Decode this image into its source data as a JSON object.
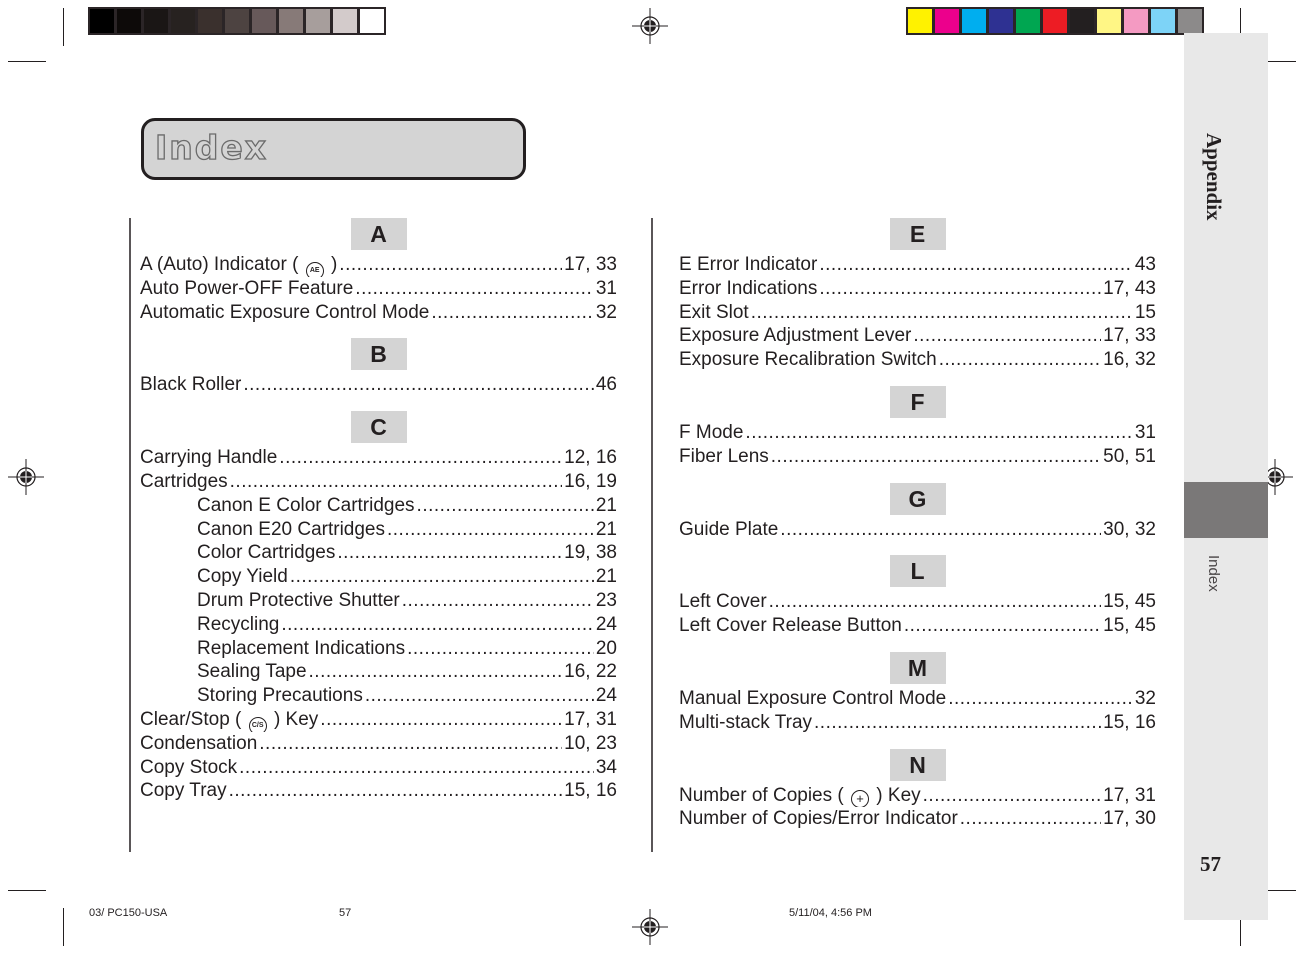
{
  "print_marks": {
    "gray_swatches": [
      "#000000",
      "#0d0a09",
      "#1a1615",
      "#272220",
      "#3a302d",
      "#4d4341",
      "#67595a",
      "#877a78",
      "#a79e9c",
      "#d3cbcb",
      "#ffffff"
    ],
    "color_swatches": [
      "#fff200",
      "#ec008c",
      "#00aeef",
      "#2e3192",
      "#00a651",
      "#ed1c24",
      "#231f20",
      "#fff685",
      "#f49ac2",
      "#7dd3f7",
      "#8c8a8a"
    ]
  },
  "side_tab": {
    "section": "Appendix",
    "active_tab": "Index",
    "page_number": "57"
  },
  "title": "Index",
  "columns": [
    {
      "sections": [
        {
          "letter": "A",
          "entries": [
            {
              "label": "A (Auto) Indicator (",
              "icon": "AE",
              "label_after": ")",
              "pages": "17, 33",
              "sub": false
            },
            {
              "label": "Auto Power-OFF Feature",
              "pages": "31",
              "sub": false
            },
            {
              "label": "Automatic Exposure Control Mode",
              "pages": "32",
              "sub": false
            }
          ]
        },
        {
          "letter": "B",
          "entries": [
            {
              "label": "Black Roller",
              "pages": "46",
              "sub": false
            }
          ]
        },
        {
          "letter": "C",
          "entries": [
            {
              "label": "Carrying Handle",
              "pages": "12, 16",
              "sub": false
            },
            {
              "label": "Cartridges",
              "pages": "16, 19",
              "sub": false
            },
            {
              "label": "Canon E Color Cartridges",
              "pages": "21",
              "sub": true
            },
            {
              "label": "Canon E20 Cartridges",
              "pages": "21",
              "sub": true
            },
            {
              "label": "Color Cartridges",
              "pages": "19, 38",
              "sub": true
            },
            {
              "label": "Copy Yield",
              "pages": "21",
              "sub": true
            },
            {
              "label": "Drum Protective Shutter",
              "pages": "23",
              "sub": true
            },
            {
              "label": "Recycling",
              "pages": "24",
              "sub": true
            },
            {
              "label": "Replacement Indications",
              "pages": "20",
              "sub": true
            },
            {
              "label": "Sealing Tape",
              "pages": "16, 22",
              "sub": true
            },
            {
              "label": "Storing Precautions",
              "pages": "24",
              "sub": true
            },
            {
              "label": "Clear/Stop (",
              "icon": "C/S",
              "label_after": ") Key",
              "pages": "17, 31",
              "sub": false
            },
            {
              "label": "Condensation",
              "pages": "10, 23",
              "sub": false
            },
            {
              "label": "Copy Stock",
              "pages": "34",
              "sub": false
            },
            {
              "label": "Copy Tray",
              "pages": "15, 16",
              "sub": false
            }
          ]
        }
      ]
    },
    {
      "sections": [
        {
          "letter": "E",
          "entries": [
            {
              "label": "E Error Indicator",
              "pages": "43",
              "sub": false
            },
            {
              "label": "Error Indications",
              "pages": "17, 43",
              "sub": false
            },
            {
              "label": "Exit Slot",
              "pages": "15",
              "sub": false
            },
            {
              "label": "Exposure Adjustment Lever",
              "pages": "17, 33",
              "sub": false
            },
            {
              "label": "Exposure Recalibration Switch",
              "pages": "16, 32",
              "sub": false
            }
          ]
        },
        {
          "letter": "F",
          "entries": [
            {
              "label": "F Mode",
              "pages": "31",
              "sub": false
            },
            {
              "label": "Fiber Lens",
              "pages": "50, 51",
              "sub": false
            }
          ]
        },
        {
          "letter": "G",
          "entries": [
            {
              "label": "Guide Plate",
              "pages": "30, 32",
              "sub": false
            }
          ]
        },
        {
          "letter": "L",
          "entries": [
            {
              "label": "Left Cover",
              "pages": "15, 45",
              "sub": false
            },
            {
              "label": "Left Cover Release Button",
              "pages": "15, 45",
              "sub": false
            }
          ]
        },
        {
          "letter": "M",
          "entries": [
            {
              "label": "Manual Exposure Control Mode",
              "pages": "32",
              "sub": false
            },
            {
              "label": "Multi-stack Tray",
              "pages": "15, 16",
              "sub": false
            }
          ]
        },
        {
          "letter": "N",
          "entries": [
            {
              "label": "Number of Copies (",
              "icon": "+",
              "label_after": ") Key",
              "pages": "17, 31",
              "sub": false
            },
            {
              "label": "Number of Copies/Error Indicator",
              "pages": "17, 30",
              "sub": false
            }
          ]
        }
      ]
    }
  ],
  "footer": {
    "job": "03/ PC150-USA",
    "page": "57",
    "timestamp": "5/11/04, 4:56 PM"
  }
}
